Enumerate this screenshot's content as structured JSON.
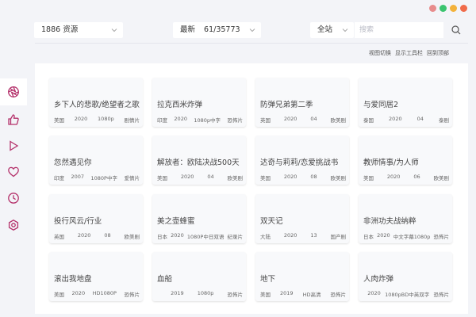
{
  "window": {
    "controls": [
      {
        "name": "close",
        "color": "#e88c8c"
      },
      {
        "name": "minimize",
        "color": "#3bc46f"
      },
      {
        "name": "maximize",
        "color": "#f3b23b"
      },
      {
        "name": "other",
        "color": "#f06b4a"
      }
    ]
  },
  "sidebar": {
    "items": [
      {
        "name": "aperture-icon",
        "active": true
      },
      {
        "name": "thumbs-up-icon"
      },
      {
        "name": "play-icon"
      },
      {
        "name": "heart-icon"
      },
      {
        "name": "clock-icon"
      },
      {
        "name": "settings-icon"
      }
    ],
    "accent": "#b4306a"
  },
  "toolbar": {
    "source_select": "1886 资源",
    "sort_select": "最新",
    "sort_count": "61/35773",
    "scope_select": "全站",
    "search_placeholder": "搜索"
  },
  "links": [
    "视图切换",
    "显示工具栏",
    "回到顶部"
  ],
  "cards": [
    {
      "title": "乡下人的悲歌/绝望者之歌",
      "region": "美国",
      "year": "2020",
      "quality": "1080p",
      "genre": "剧情片"
    },
    {
      "title": "拉克西米炸弹",
      "region": "印度",
      "year": "2020",
      "quality": "1080p中字",
      "genre": "恐怖片"
    },
    {
      "title": "防弹兄弟第二季",
      "region": "英国",
      "year": "2020",
      "quality": "04",
      "genre": "欧美剧"
    },
    {
      "title": "与爱同居2",
      "region": "泰国",
      "year": "2020",
      "quality": "04",
      "genre": "泰剧"
    },
    {
      "title": "忽然遇见你",
      "region": "印度",
      "year": "2007",
      "quality": "1080P中字",
      "genre": "爱情片"
    },
    {
      "title": "解放者：欧陆决战500天",
      "region": "美国",
      "year": "2020",
      "quality": "04",
      "genre": "欧美剧"
    },
    {
      "title": "达奇与莉莉/恋爱挑战书",
      "region": "美国",
      "year": "2020",
      "quality": "08",
      "genre": "欧美剧"
    },
    {
      "title": "教师情事/为人师",
      "region": "美国",
      "year": "2020",
      "quality": "06",
      "genre": "欧美剧"
    },
    {
      "title": "投行风云/行业",
      "region": "英国",
      "year": "2020",
      "quality": "08",
      "genre": "欧美剧"
    },
    {
      "title": "美之壶蜂蜜",
      "region": "日本",
      "year": "2020",
      "quality": "1080P中日双语",
      "genre": "纪录片"
    },
    {
      "title": "双天记",
      "region": "大陆",
      "year": "2020",
      "quality": "13",
      "genre": "国产剧"
    },
    {
      "title": "非洲功夫战纳粹",
      "region": "日本",
      "year": "2020",
      "quality": "中文字幕1080p",
      "genre": "恐怖片"
    },
    {
      "title": "滚出我地盘",
      "region": "美国",
      "year": "2020",
      "quality": "HD1080P",
      "genre": "恐怖片"
    },
    {
      "title": "血船",
      "region": "",
      "year": "2019",
      "quality": "1080p",
      "genre": "恐怖片"
    },
    {
      "title": "地下",
      "region": "美国",
      "year": "2019",
      "quality": "HD高清",
      "genre": "恐怖片"
    },
    {
      "title": "人肉炸弹",
      "region": "",
      "year": "2020",
      "quality": "1080pBD中英双字",
      "genre": "恐怖片"
    }
  ]
}
